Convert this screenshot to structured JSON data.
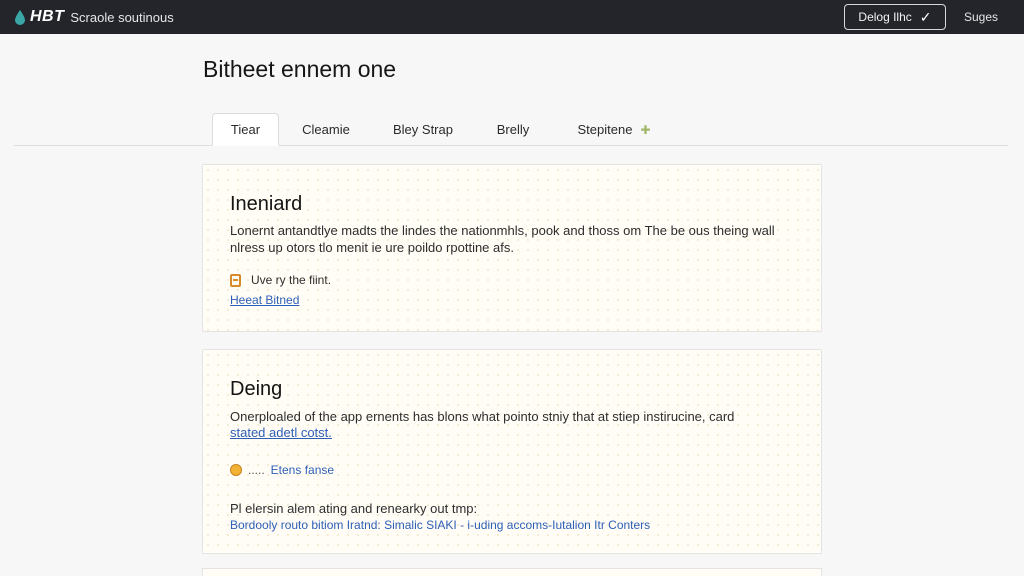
{
  "header": {
    "brand": "HBT",
    "subtitle": "Scraole soutinous",
    "button_label": "Delog Ilhc",
    "link_label": "Suges"
  },
  "page": {
    "title": "Bitheet ennem one"
  },
  "tabs": [
    {
      "label": "Tiear",
      "active": true
    },
    {
      "label": "Cleamie",
      "active": false
    },
    {
      "label": "Bley Strap",
      "active": false
    },
    {
      "label": "Brelly",
      "active": false
    },
    {
      "label": "Stepitene",
      "active": false
    }
  ],
  "cards": [
    {
      "title": "Ineniard",
      "text_line1": "Lonernt antandtlye madts the lindes the nationmhls, pook and thoss om The be ous theing wall",
      "text_line2": "nlress up otors tlo menit ie ure poildo rpottine afs.",
      "row_text": "Uve ry the fiint.",
      "link": "Heeat Bitned"
    },
    {
      "title": "Deing",
      "text_line1": "Onerploaled of the app ernents has blons what pointo stniy that at stiep instirucine, card",
      "link_line": "stated adetl cotst.",
      "row_dots": ".....",
      "row_link": "Etens fanse",
      "text_line3": "Pl elersin alem ating and renearky out tmp:",
      "blue_line": "Bordooly routo bitiom Iratnd: Simalic SIAKI - i-uding accoms-Iutalion Itr Conters"
    }
  ],
  "colors": {
    "topbar": "#23252b",
    "link": "#2e5fb8",
    "accent_icon": "#d98b2b"
  }
}
